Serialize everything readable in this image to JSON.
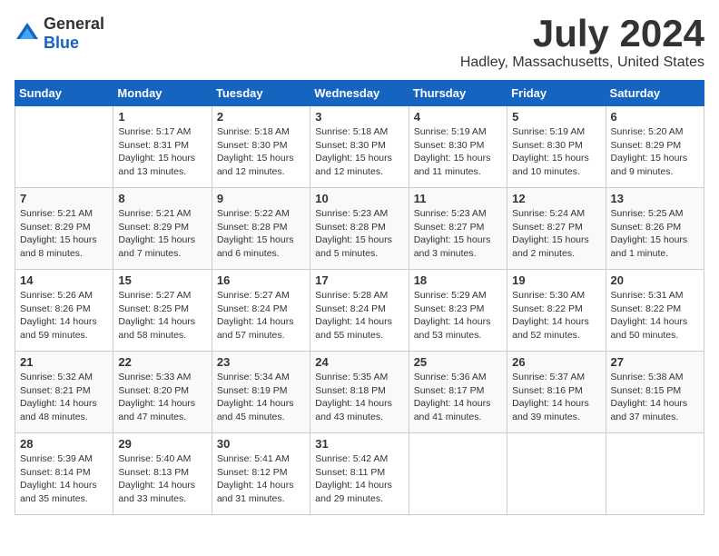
{
  "logo": {
    "text_general": "General",
    "text_blue": "Blue"
  },
  "title": "July 2024",
  "subtitle": "Hadley, Massachusetts, United States",
  "weekdays": [
    "Sunday",
    "Monday",
    "Tuesday",
    "Wednesday",
    "Thursday",
    "Friday",
    "Saturday"
  ],
  "weeks": [
    [
      {
        "day": "",
        "info": ""
      },
      {
        "day": "1",
        "info": "Sunrise: 5:17 AM\nSunset: 8:31 PM\nDaylight: 15 hours\nand 13 minutes."
      },
      {
        "day": "2",
        "info": "Sunrise: 5:18 AM\nSunset: 8:30 PM\nDaylight: 15 hours\nand 12 minutes."
      },
      {
        "day": "3",
        "info": "Sunrise: 5:18 AM\nSunset: 8:30 PM\nDaylight: 15 hours\nand 12 minutes."
      },
      {
        "day": "4",
        "info": "Sunrise: 5:19 AM\nSunset: 8:30 PM\nDaylight: 15 hours\nand 11 minutes."
      },
      {
        "day": "5",
        "info": "Sunrise: 5:19 AM\nSunset: 8:30 PM\nDaylight: 15 hours\nand 10 minutes."
      },
      {
        "day": "6",
        "info": "Sunrise: 5:20 AM\nSunset: 8:29 PM\nDaylight: 15 hours\nand 9 minutes."
      }
    ],
    [
      {
        "day": "7",
        "info": "Sunrise: 5:21 AM\nSunset: 8:29 PM\nDaylight: 15 hours\nand 8 minutes."
      },
      {
        "day": "8",
        "info": "Sunrise: 5:21 AM\nSunset: 8:29 PM\nDaylight: 15 hours\nand 7 minutes."
      },
      {
        "day": "9",
        "info": "Sunrise: 5:22 AM\nSunset: 8:28 PM\nDaylight: 15 hours\nand 6 minutes."
      },
      {
        "day": "10",
        "info": "Sunrise: 5:23 AM\nSunset: 8:28 PM\nDaylight: 15 hours\nand 5 minutes."
      },
      {
        "day": "11",
        "info": "Sunrise: 5:23 AM\nSunset: 8:27 PM\nDaylight: 15 hours\nand 3 minutes."
      },
      {
        "day": "12",
        "info": "Sunrise: 5:24 AM\nSunset: 8:27 PM\nDaylight: 15 hours\nand 2 minutes."
      },
      {
        "day": "13",
        "info": "Sunrise: 5:25 AM\nSunset: 8:26 PM\nDaylight: 15 hours\nand 1 minute."
      }
    ],
    [
      {
        "day": "14",
        "info": "Sunrise: 5:26 AM\nSunset: 8:26 PM\nDaylight: 14 hours\nand 59 minutes."
      },
      {
        "day": "15",
        "info": "Sunrise: 5:27 AM\nSunset: 8:25 PM\nDaylight: 14 hours\nand 58 minutes."
      },
      {
        "day": "16",
        "info": "Sunrise: 5:27 AM\nSunset: 8:24 PM\nDaylight: 14 hours\nand 57 minutes."
      },
      {
        "day": "17",
        "info": "Sunrise: 5:28 AM\nSunset: 8:24 PM\nDaylight: 14 hours\nand 55 minutes."
      },
      {
        "day": "18",
        "info": "Sunrise: 5:29 AM\nSunset: 8:23 PM\nDaylight: 14 hours\nand 53 minutes."
      },
      {
        "day": "19",
        "info": "Sunrise: 5:30 AM\nSunset: 8:22 PM\nDaylight: 14 hours\nand 52 minutes."
      },
      {
        "day": "20",
        "info": "Sunrise: 5:31 AM\nSunset: 8:22 PM\nDaylight: 14 hours\nand 50 minutes."
      }
    ],
    [
      {
        "day": "21",
        "info": "Sunrise: 5:32 AM\nSunset: 8:21 PM\nDaylight: 14 hours\nand 48 minutes."
      },
      {
        "day": "22",
        "info": "Sunrise: 5:33 AM\nSunset: 8:20 PM\nDaylight: 14 hours\nand 47 minutes."
      },
      {
        "day": "23",
        "info": "Sunrise: 5:34 AM\nSunset: 8:19 PM\nDaylight: 14 hours\nand 45 minutes."
      },
      {
        "day": "24",
        "info": "Sunrise: 5:35 AM\nSunset: 8:18 PM\nDaylight: 14 hours\nand 43 minutes."
      },
      {
        "day": "25",
        "info": "Sunrise: 5:36 AM\nSunset: 8:17 PM\nDaylight: 14 hours\nand 41 minutes."
      },
      {
        "day": "26",
        "info": "Sunrise: 5:37 AM\nSunset: 8:16 PM\nDaylight: 14 hours\nand 39 minutes."
      },
      {
        "day": "27",
        "info": "Sunrise: 5:38 AM\nSunset: 8:15 PM\nDaylight: 14 hours\nand 37 minutes."
      }
    ],
    [
      {
        "day": "28",
        "info": "Sunrise: 5:39 AM\nSunset: 8:14 PM\nDaylight: 14 hours\nand 35 minutes."
      },
      {
        "day": "29",
        "info": "Sunrise: 5:40 AM\nSunset: 8:13 PM\nDaylight: 14 hours\nand 33 minutes."
      },
      {
        "day": "30",
        "info": "Sunrise: 5:41 AM\nSunset: 8:12 PM\nDaylight: 14 hours\nand 31 minutes."
      },
      {
        "day": "31",
        "info": "Sunrise: 5:42 AM\nSunset: 8:11 PM\nDaylight: 14 hours\nand 29 minutes."
      },
      {
        "day": "",
        "info": ""
      },
      {
        "day": "",
        "info": ""
      },
      {
        "day": "",
        "info": ""
      }
    ]
  ]
}
